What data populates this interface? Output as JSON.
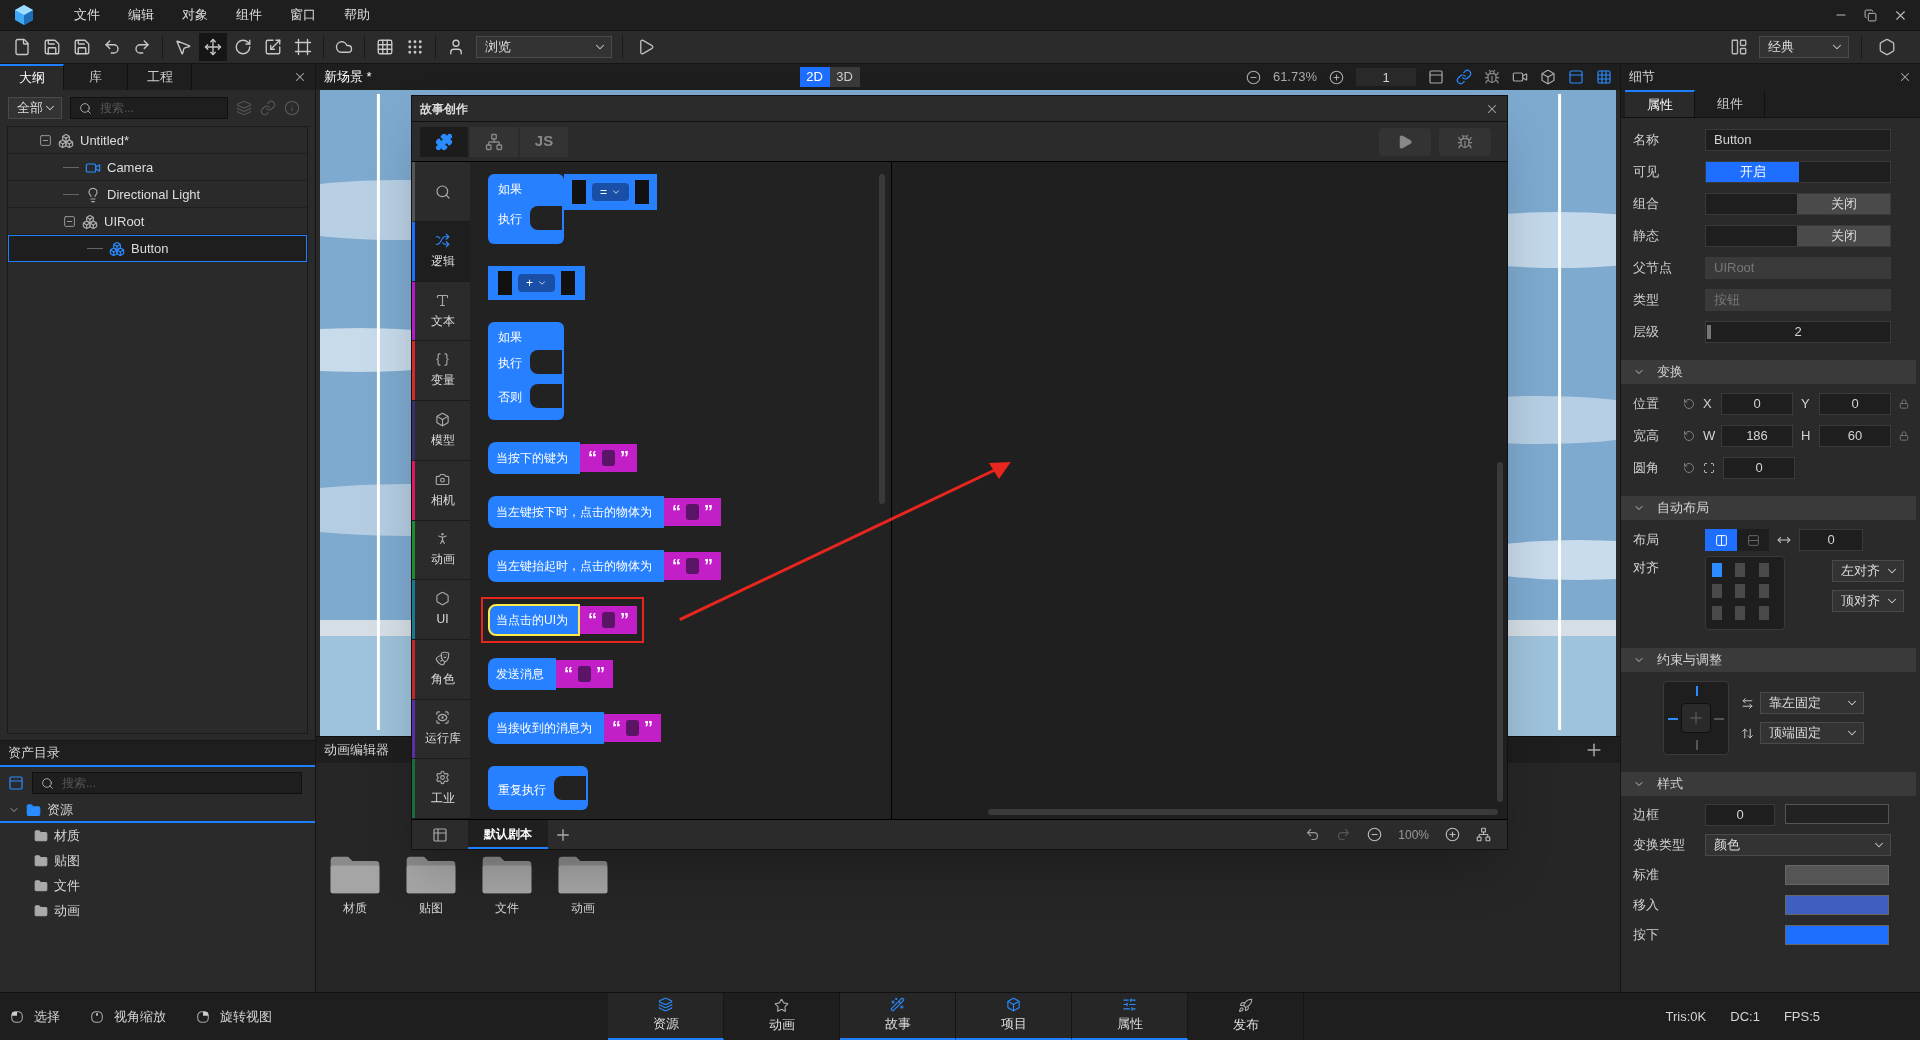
{
  "menu": [
    "文件",
    "编辑",
    "对象",
    "组件",
    "窗口",
    "帮助"
  ],
  "toolbar": {
    "mode": "浏览",
    "layout": "经典"
  },
  "outline": {
    "tabs": [
      {
        "label": "大纲",
        "selected": true
      },
      {
        "label": "库",
        "selected": false
      },
      {
        "label": "工程",
        "selected": false
      }
    ],
    "filter": "全部",
    "search_placeholder": "搜索...",
    "tree": [
      {
        "kind": "group",
        "label": "Untitled*",
        "expanded": true,
        "selected": false,
        "children": [
          {
            "kind": "camera",
            "label": "Camera",
            "selected": false
          },
          {
            "kind": "light",
            "label": "Directional Light",
            "selected": false
          },
          {
            "kind": "group",
            "label": "UIRoot",
            "expanded": true,
            "selected": false,
            "children": [
              {
                "kind": "ui",
                "label": "Button",
                "selected": true
              }
            ]
          }
        ]
      }
    ]
  },
  "scene": {
    "tab": "新场景 *",
    "view_modes": [
      {
        "label": "2D",
        "selected": true
      },
      {
        "label": "3D",
        "selected": false
      }
    ],
    "zoom": "61.73%",
    "layer": "1"
  },
  "story": {
    "title": "故事创作",
    "tabs": [
      {
        "kind": "blocks",
        "selected": true
      },
      {
        "kind": "structure",
        "selected": false
      },
      {
        "kind": "code",
        "label": "JS",
        "selected": false
      }
    ],
    "categories": [
      {
        "kind": "logic",
        "label": "逻辑",
        "color": "#1e6fff",
        "selected": true
      },
      {
        "kind": "text",
        "label": "文本",
        "color": "#b41bc4",
        "selected": false
      },
      {
        "kind": "variable",
        "label": "变量",
        "color": "#d42a2a",
        "selected": false
      },
      {
        "kind": "model",
        "label": "模型",
        "color": "#3a2f6b",
        "selected": false
      },
      {
        "kind": "camera",
        "label": "相机",
        "color": "#d81b60",
        "selected": false
      },
      {
        "kind": "animation",
        "label": "动画",
        "color": "#1f8a2e",
        "selected": false
      },
      {
        "kind": "ui",
        "label": "UI",
        "color": "#1b7a8c",
        "selected": false
      },
      {
        "kind": "character",
        "label": "角色",
        "color": "#c0282a",
        "selected": false
      },
      {
        "kind": "library",
        "label": "运行库",
        "color": "#5a2ea6",
        "selected": false
      },
      {
        "kind": "industry",
        "label": "工业",
        "color": "#1c6b3c",
        "selected": false
      }
    ],
    "blocks": [
      {
        "kind": "if",
        "labels": [
          "如果",
          "执行"
        ],
        "operator": "=",
        "selected": false
      },
      {
        "kind": "math",
        "operator": "+",
        "selected": false
      },
      {
        "kind": "if_else",
        "labels": [
          "如果",
          "执行",
          "否则"
        ],
        "selected": false
      },
      {
        "kind": "event",
        "label": "当按下的键为",
        "quotes": [
          "“",
          "”"
        ],
        "selected": false
      },
      {
        "kind": "event",
        "label": "当左键按下时，点击的物体为",
        "quotes": [
          "“",
          "”"
        ],
        "selected": false
      },
      {
        "kind": "event",
        "label": "当左键抬起时，点击的物体为",
        "quotes": [
          "“",
          "”"
        ],
        "selected": false
      },
      {
        "kind": "event",
        "label": "当点击的UI为",
        "quotes": [
          "“",
          "”"
        ],
        "selected": true
      },
      {
        "kind": "event",
        "label": "发送消息",
        "quotes": [
          "“",
          "”"
        ],
        "selected": false
      },
      {
        "kind": "event",
        "label": "当接收到的消息为",
        "quotes": [
          "“",
          "”"
        ],
        "selected": false
      },
      {
        "kind": "loop",
        "label": "重复执行",
        "selected": false
      }
    ],
    "script_tabs": [
      {
        "label": "默认剧本",
        "selected": true
      }
    ],
    "zoom": "100%"
  },
  "assets": {
    "title": "资产目录",
    "search_placeholder": "搜索...",
    "tree": [
      {
        "label": "资源",
        "expanded": true,
        "selected": true,
        "children": [
          {
            "label": "材质",
            "selected": false
          },
          {
            "label": "贴图",
            "selected": false
          },
          {
            "label": "文件",
            "selected": false
          },
          {
            "label": "动画",
            "selected": false
          }
        ]
      }
    ],
    "folders": [
      {
        "label": "材质"
      },
      {
        "label": "贴图"
      },
      {
        "label": "文件"
      },
      {
        "label": "动画"
      }
    ]
  },
  "animation_editor": {
    "title": "动画编辑器"
  },
  "details": {
    "title": "细节",
    "tabs": [
      {
        "label": "属性",
        "selected": true
      },
      {
        "label": "组件",
        "selected": false
      }
    ],
    "general": [
      {
        "kind": "text",
        "label": "名称",
        "value": "Button"
      },
      {
        "kind": "toggle",
        "label": "可见",
        "on": true,
        "text": "开启"
      },
      {
        "kind": "toggle",
        "label": "组合",
        "on": false,
        "text": "关闭"
      },
      {
        "kind": "toggle",
        "label": "静态",
        "on": false,
        "text": "关闭"
      },
      {
        "kind": "readonly",
        "label": "父节点",
        "value": "UIRoot"
      },
      {
        "kind": "readonly",
        "label": "类型",
        "value": "按钮"
      },
      {
        "kind": "slider",
        "label": "层级",
        "value": "2",
        "level": 0
      }
    ],
    "transform": {
      "title": "变换",
      "expanded": true,
      "rows": [
        {
          "label": "位置",
          "locked": true,
          "fields": [
            {
              "axis": "X",
              "value": "0"
            },
            {
              "axis": "Y",
              "value": "0"
            }
          ]
        },
        {
          "label": "宽高",
          "locked": true,
          "fields": [
            {
              "axis": "W",
              "value": "186"
            },
            {
              "axis": "H",
              "value": "60"
            }
          ]
        },
        {
          "label": "圆角",
          "fields": [
            {
              "value": "0"
            }
          ]
        }
      ]
    },
    "layout": {
      "title": "自动布局",
      "expanded": true,
      "label": "布局",
      "directions": [
        {
          "kind": "horizontal",
          "selected": true
        },
        {
          "kind": "vertical",
          "selected": false
        }
      ],
      "spacing": "0",
      "align_label": "对齐",
      "align_cells": [
        {
          "selected": true
        },
        {
          "selected": false
        },
        {
          "selected": false
        },
        {
          "selected": false
        },
        {
          "selected": false
        },
        {
          "selected": false
        },
        {
          "selected": false
        },
        {
          "selected": false
        },
        {
          "selected": false
        }
      ],
      "h_align": "左对齐",
      "v_align": "顶对齐"
    },
    "constraints": {
      "title": "约束与调整",
      "expanded": true,
      "anchors": {
        "top": true,
        "left": true,
        "right": false,
        "bottom": false
      },
      "horizontal": "靠左固定",
      "vertical": "顶端固定"
    },
    "style": {
      "title": "样式",
      "expanded": true,
      "rows": [
        {
          "kind": "border",
          "label": "边框",
          "value": "0",
          "color": "#222222"
        },
        {
          "kind": "select",
          "label": "变换类型",
          "value": "颜色"
        },
        {
          "kind": "swatch",
          "label": "标准",
          "color": "#555555"
        },
        {
          "kind": "swatch",
          "label": "移入",
          "color": "#3f5fbf"
        },
        {
          "kind": "swatch",
          "label": "按下",
          "color": "#1e6fff"
        }
      ]
    }
  },
  "status_bar": {
    "hints": [
      {
        "kind": "left",
        "label": "选择"
      },
      {
        "kind": "middle",
        "label": "视角缩放"
      },
      {
        "kind": "right",
        "label": "旋转视图"
      }
    ],
    "tabs": [
      {
        "kind": "assets",
        "label": "资源",
        "selected": true
      },
      {
        "kind": "animation",
        "label": "动画",
        "selected": false
      },
      {
        "kind": "story",
        "label": "故事",
        "selected": true
      },
      {
        "kind": "project",
        "label": "项目",
        "selected": true
      },
      {
        "kind": "properties",
        "label": "属性",
        "selected": true
      },
      {
        "kind": "publish",
        "label": "发布",
        "selected": false
      }
    ],
    "stats": [
      "Tris:0K",
      "DC:1",
      "FPS:5"
    ]
  }
}
